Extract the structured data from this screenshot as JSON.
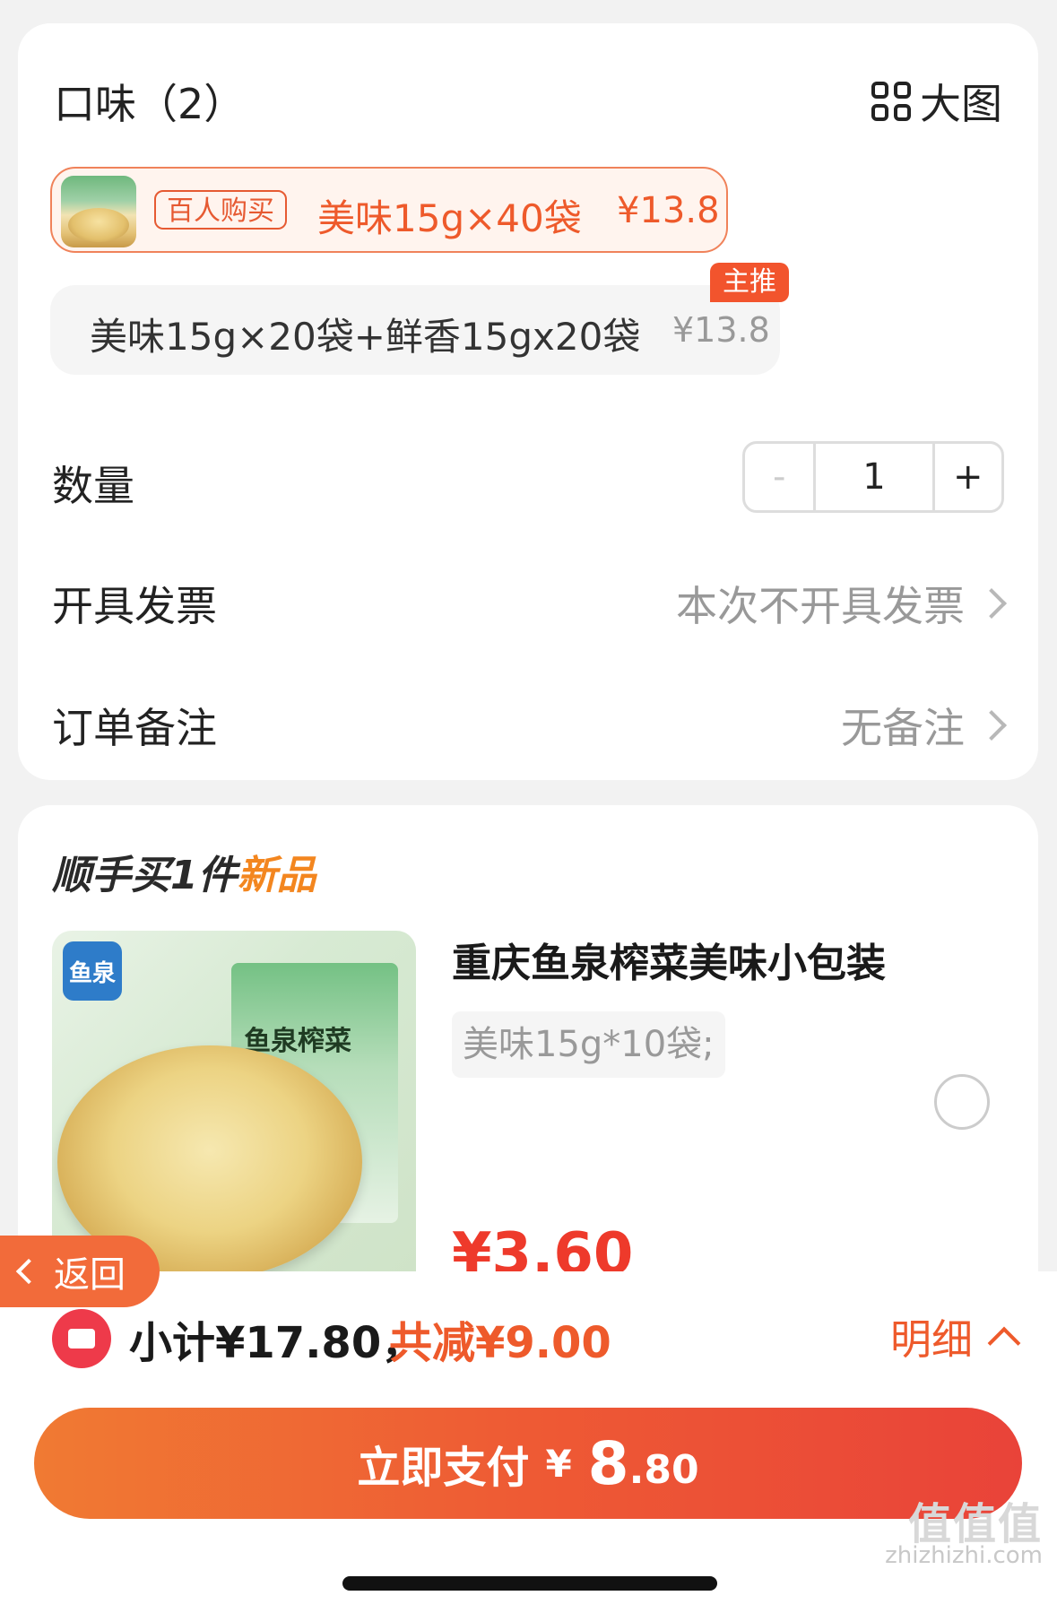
{
  "flavor": {
    "title": "口味（2）",
    "big_image_label": "大图",
    "options": [
      {
        "badge": "百人购买",
        "name": "美味15g×40袋",
        "price": "¥13.8",
        "selected": true
      },
      {
        "name": "美味15g×20袋+鲜香15gx20袋",
        "price": "¥13.8",
        "tag": "主推",
        "selected": false
      }
    ]
  },
  "quantity": {
    "label": "数量",
    "minus": "-",
    "value": "1",
    "plus": "+"
  },
  "invoice": {
    "label": "开具发票",
    "value": "本次不开具发票"
  },
  "order_note": {
    "label": "订单备注",
    "value": "无备注"
  },
  "addon": {
    "title_main": "顺手买1件",
    "title_highlight": "新品",
    "product": {
      "name": "重庆鱼泉榨菜美味小包装",
      "spec": "美味15g*10袋;",
      "price_partial": "¥3.60",
      "pack_text": "鱼泉榨菜",
      "logo_text": "鱼泉"
    }
  },
  "bottom": {
    "subtotal": "小计¥17.80，",
    "discount": "共减¥9.00",
    "detail_label": "明细",
    "pay": {
      "label": "立即支付",
      "currency": "¥",
      "amount_int": "8",
      "amount_dec": ".80"
    }
  },
  "back": {
    "label": "返回"
  },
  "watermark": {
    "text": "zhizhizhi.com",
    "logo_text": "值值值"
  },
  "colors": {
    "accent": "#ee5a2b",
    "price_red": "#ee3a2b",
    "new_orange": "#f3861f",
    "tag_red": "#f2542d"
  }
}
